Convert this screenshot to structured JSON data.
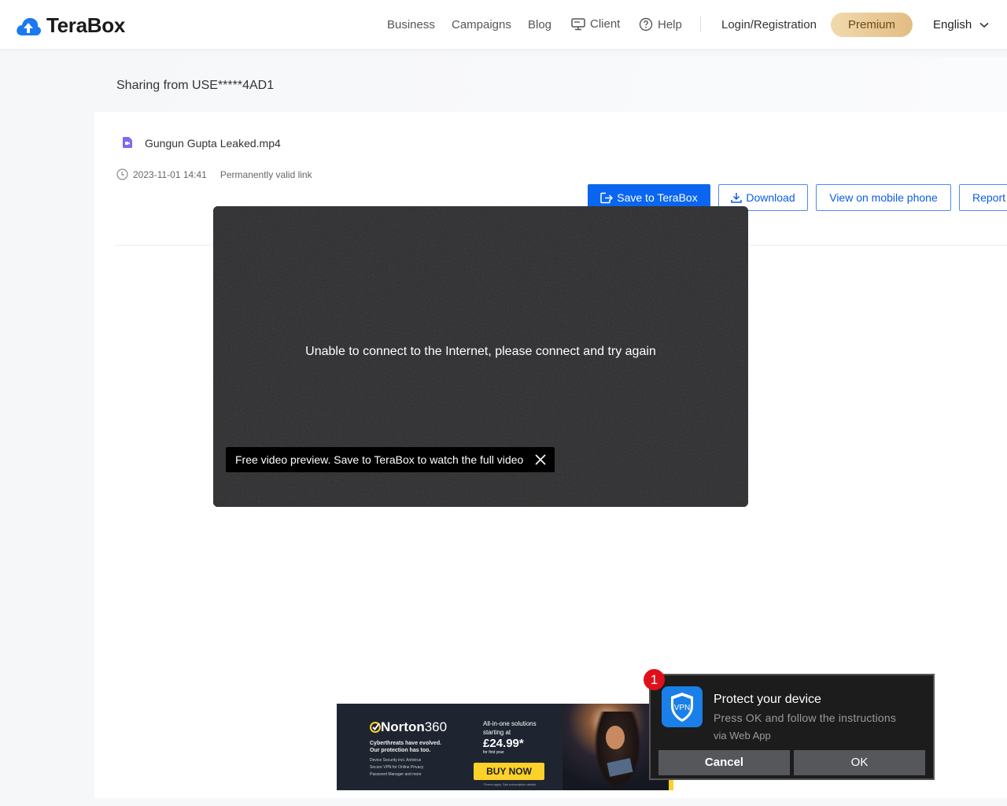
{
  "header": {
    "brand": "TeraBox",
    "nav": {
      "business": "Business",
      "campaigns": "Campaigns",
      "blog": "Blog",
      "client": "Client",
      "help": "Help"
    },
    "login": "Login/Registration",
    "premium": "Premium",
    "language": "English"
  },
  "share": {
    "title": "Sharing from USE*****4AD1"
  },
  "file": {
    "name": "Gungun Gupta Leaked.mp4",
    "date": "2023-11-01 14:41",
    "validity": "Permanently valid link"
  },
  "actions": {
    "save": "Save to TeraBox",
    "download": "Download",
    "mobile": "View on mobile phone",
    "report": "Report"
  },
  "video": {
    "error_message": "Unable to connect to the Internet, please connect and try again",
    "preview_tip": "Free video preview. Save to TeraBox to watch the full video"
  },
  "ad": {
    "brand": "Norton",
    "brand_suffix": "360",
    "tagline_1": "Cyberthreats have evolved.",
    "tagline_2": "Our protection has too.",
    "feature_1": "Device Security incl. Antivirus",
    "feature_2": "Secure VPN for Online Privacy",
    "feature_3": "Password Manager and more",
    "offer_1": "All-in-one solutions",
    "offer_2": "starting at",
    "price": "£24.99*",
    "price_note": "for first year",
    "cta": "BUY NOW",
    "terms": "*Terms apply. See subscription details."
  },
  "popup": {
    "badge": "1",
    "icon_label": "VPN",
    "title": "Protect your device",
    "message": "Press OK and follow the instructions",
    "via": "via Web App",
    "cancel": "Cancel",
    "ok": "OK"
  },
  "colors": {
    "primary": "#0a66f0",
    "premium": "#e2bd82",
    "ad_yellow": "#fcd12a",
    "badge_red": "#e0101b"
  }
}
